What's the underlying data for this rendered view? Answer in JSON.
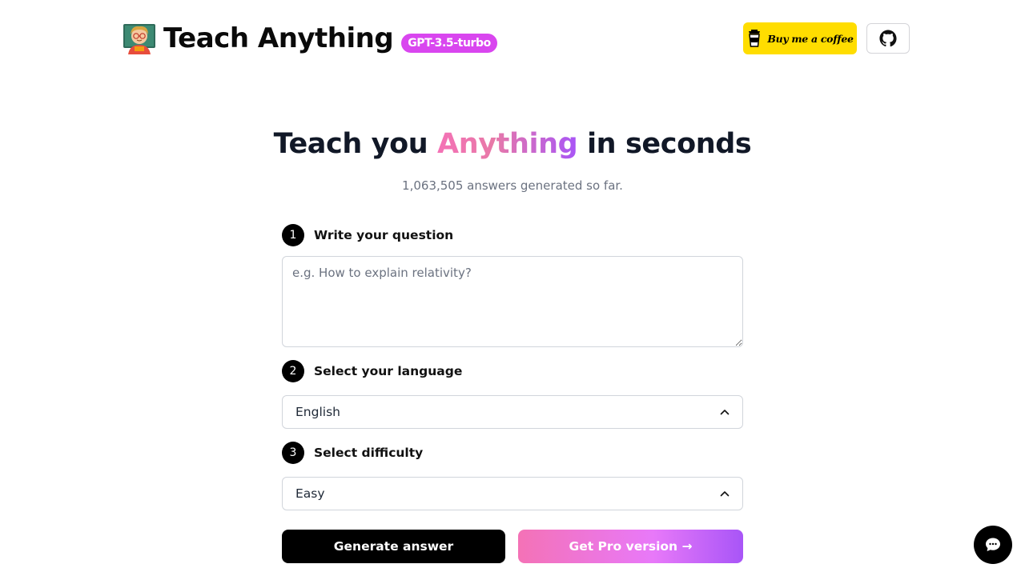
{
  "header": {
    "brand": "Teach Anything",
    "model_badge": "GPT-3.5-turbo",
    "coffee_label": "Buy me a coffee",
    "logo_icon": "teacher-emoji-icon",
    "github_icon": "github-icon"
  },
  "hero": {
    "title_before": "Teach you ",
    "title_highlight": "Anything",
    "title_after": " in seconds",
    "subtitle": "1,063,505 answers generated so far."
  },
  "form": {
    "step1": {
      "number": "1",
      "label": "Write your question"
    },
    "question": {
      "value": "",
      "placeholder": "e.g. How to explain relativity?"
    },
    "step2": {
      "number": "2",
      "label": "Select your language"
    },
    "language": {
      "selected": "English"
    },
    "step3": {
      "number": "3",
      "label": "Select difficulty"
    },
    "difficulty": {
      "selected": "Easy"
    },
    "generate_label": "Generate answer",
    "pro_label": "Get Pro version →"
  },
  "colors": {
    "badge": "#d946ef",
    "coffee_bg": "#ffdd00",
    "gradient_start": "#f472b6",
    "gradient_end": "#a855f7"
  }
}
